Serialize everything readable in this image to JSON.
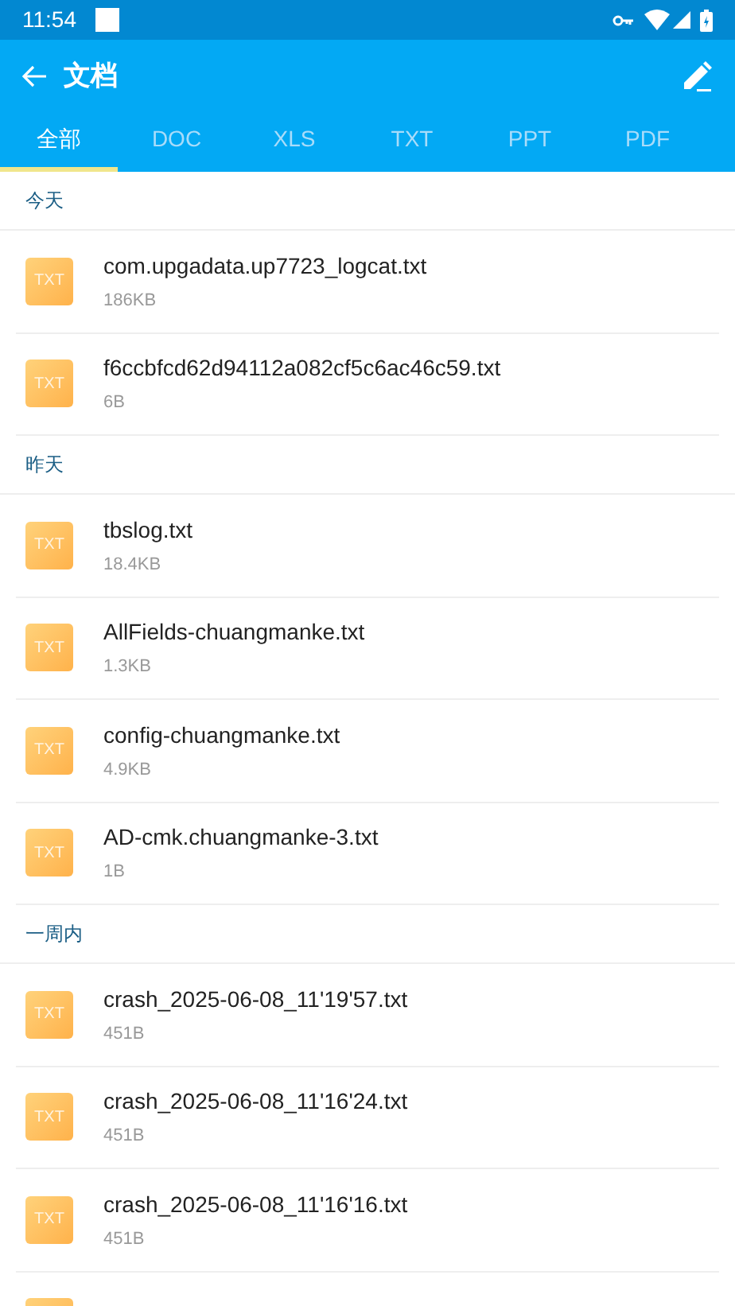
{
  "status_bar": {
    "time": "11:54"
  },
  "app_bar": {
    "title": "文档"
  },
  "tabs": [
    {
      "label": "全部",
      "selected": true
    },
    {
      "label": "DOC",
      "selected": false
    },
    {
      "label": "XLS",
      "selected": false
    },
    {
      "label": "TXT",
      "selected": false
    },
    {
      "label": "PPT",
      "selected": false
    },
    {
      "label": "PDF",
      "selected": false
    }
  ],
  "sections": [
    {
      "title": "今天",
      "files": [
        {
          "type": "TXT",
          "name": "com.upgadata.up7723_logcat.txt",
          "size": "186KB"
        },
        {
          "type": "TXT",
          "name": "f6ccbfcd62d94112a082cf5c6ac46c59.txt",
          "size": "6B"
        }
      ]
    },
    {
      "title": "昨天",
      "files": [
        {
          "type": "TXT",
          "name": "tbslog.txt",
          "size": "18.4KB"
        },
        {
          "type": "TXT",
          "name": "AllFields-chuangmanke.txt",
          "size": "1.3KB"
        },
        {
          "type": "TXT",
          "name": "config-chuangmanke.txt",
          "size": "4.9KB"
        },
        {
          "type": "TXT",
          "name": "AD-cmk.chuangmanke-3.txt",
          "size": "1B"
        }
      ]
    },
    {
      "title": "一周内",
      "files": [
        {
          "type": "TXT",
          "name": "crash_2025-06-08_11'19'57.txt",
          "size": "451B"
        },
        {
          "type": "TXT",
          "name": "crash_2025-06-08_11'16'24.txt",
          "size": "451B"
        },
        {
          "type": "TXT",
          "name": "crash_2025-06-08_11'16'16.txt",
          "size": "451B"
        }
      ]
    }
  ]
}
